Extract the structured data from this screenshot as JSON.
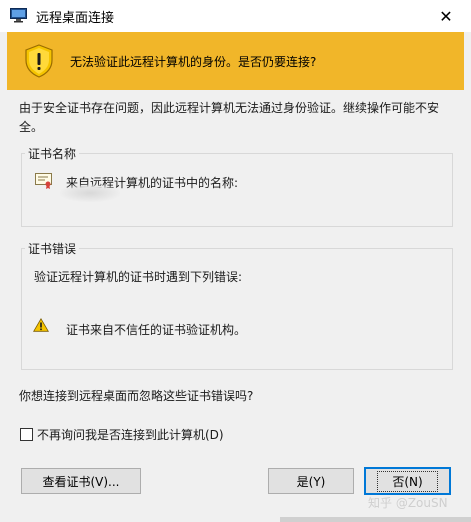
{
  "window": {
    "title": "远程桌面连接",
    "close_glyph": "✕"
  },
  "banner": {
    "message": "无法验证此远程计算机的身份。是否仍要连接?",
    "color": "#f1b629"
  },
  "intro_text": "由于安全证书存在问题，因此远程计算机无法通过身份验证。继续操作可能不安全。",
  "cert_name_group": {
    "label": "证书名称",
    "from_text": "来自远程计算机的证书中的名称:"
  },
  "cert_error_group": {
    "label": "证书错误",
    "line": "验证远程计算机的证书时遇到下列错误:",
    "error_detail": "证书来自不信任的证书验证机构。"
  },
  "question": "你想连接到远程桌面而忽略这些证书错误吗?",
  "checkbox": {
    "label": "不再询问我是否连接到此计算机(D)",
    "checked": false
  },
  "buttons": {
    "view_cert": "查看证书(V)...",
    "yes": "是(Y)",
    "no": "否(N)"
  },
  "accent": "#0078d7",
  "watermark": "知乎 @ZouSN"
}
